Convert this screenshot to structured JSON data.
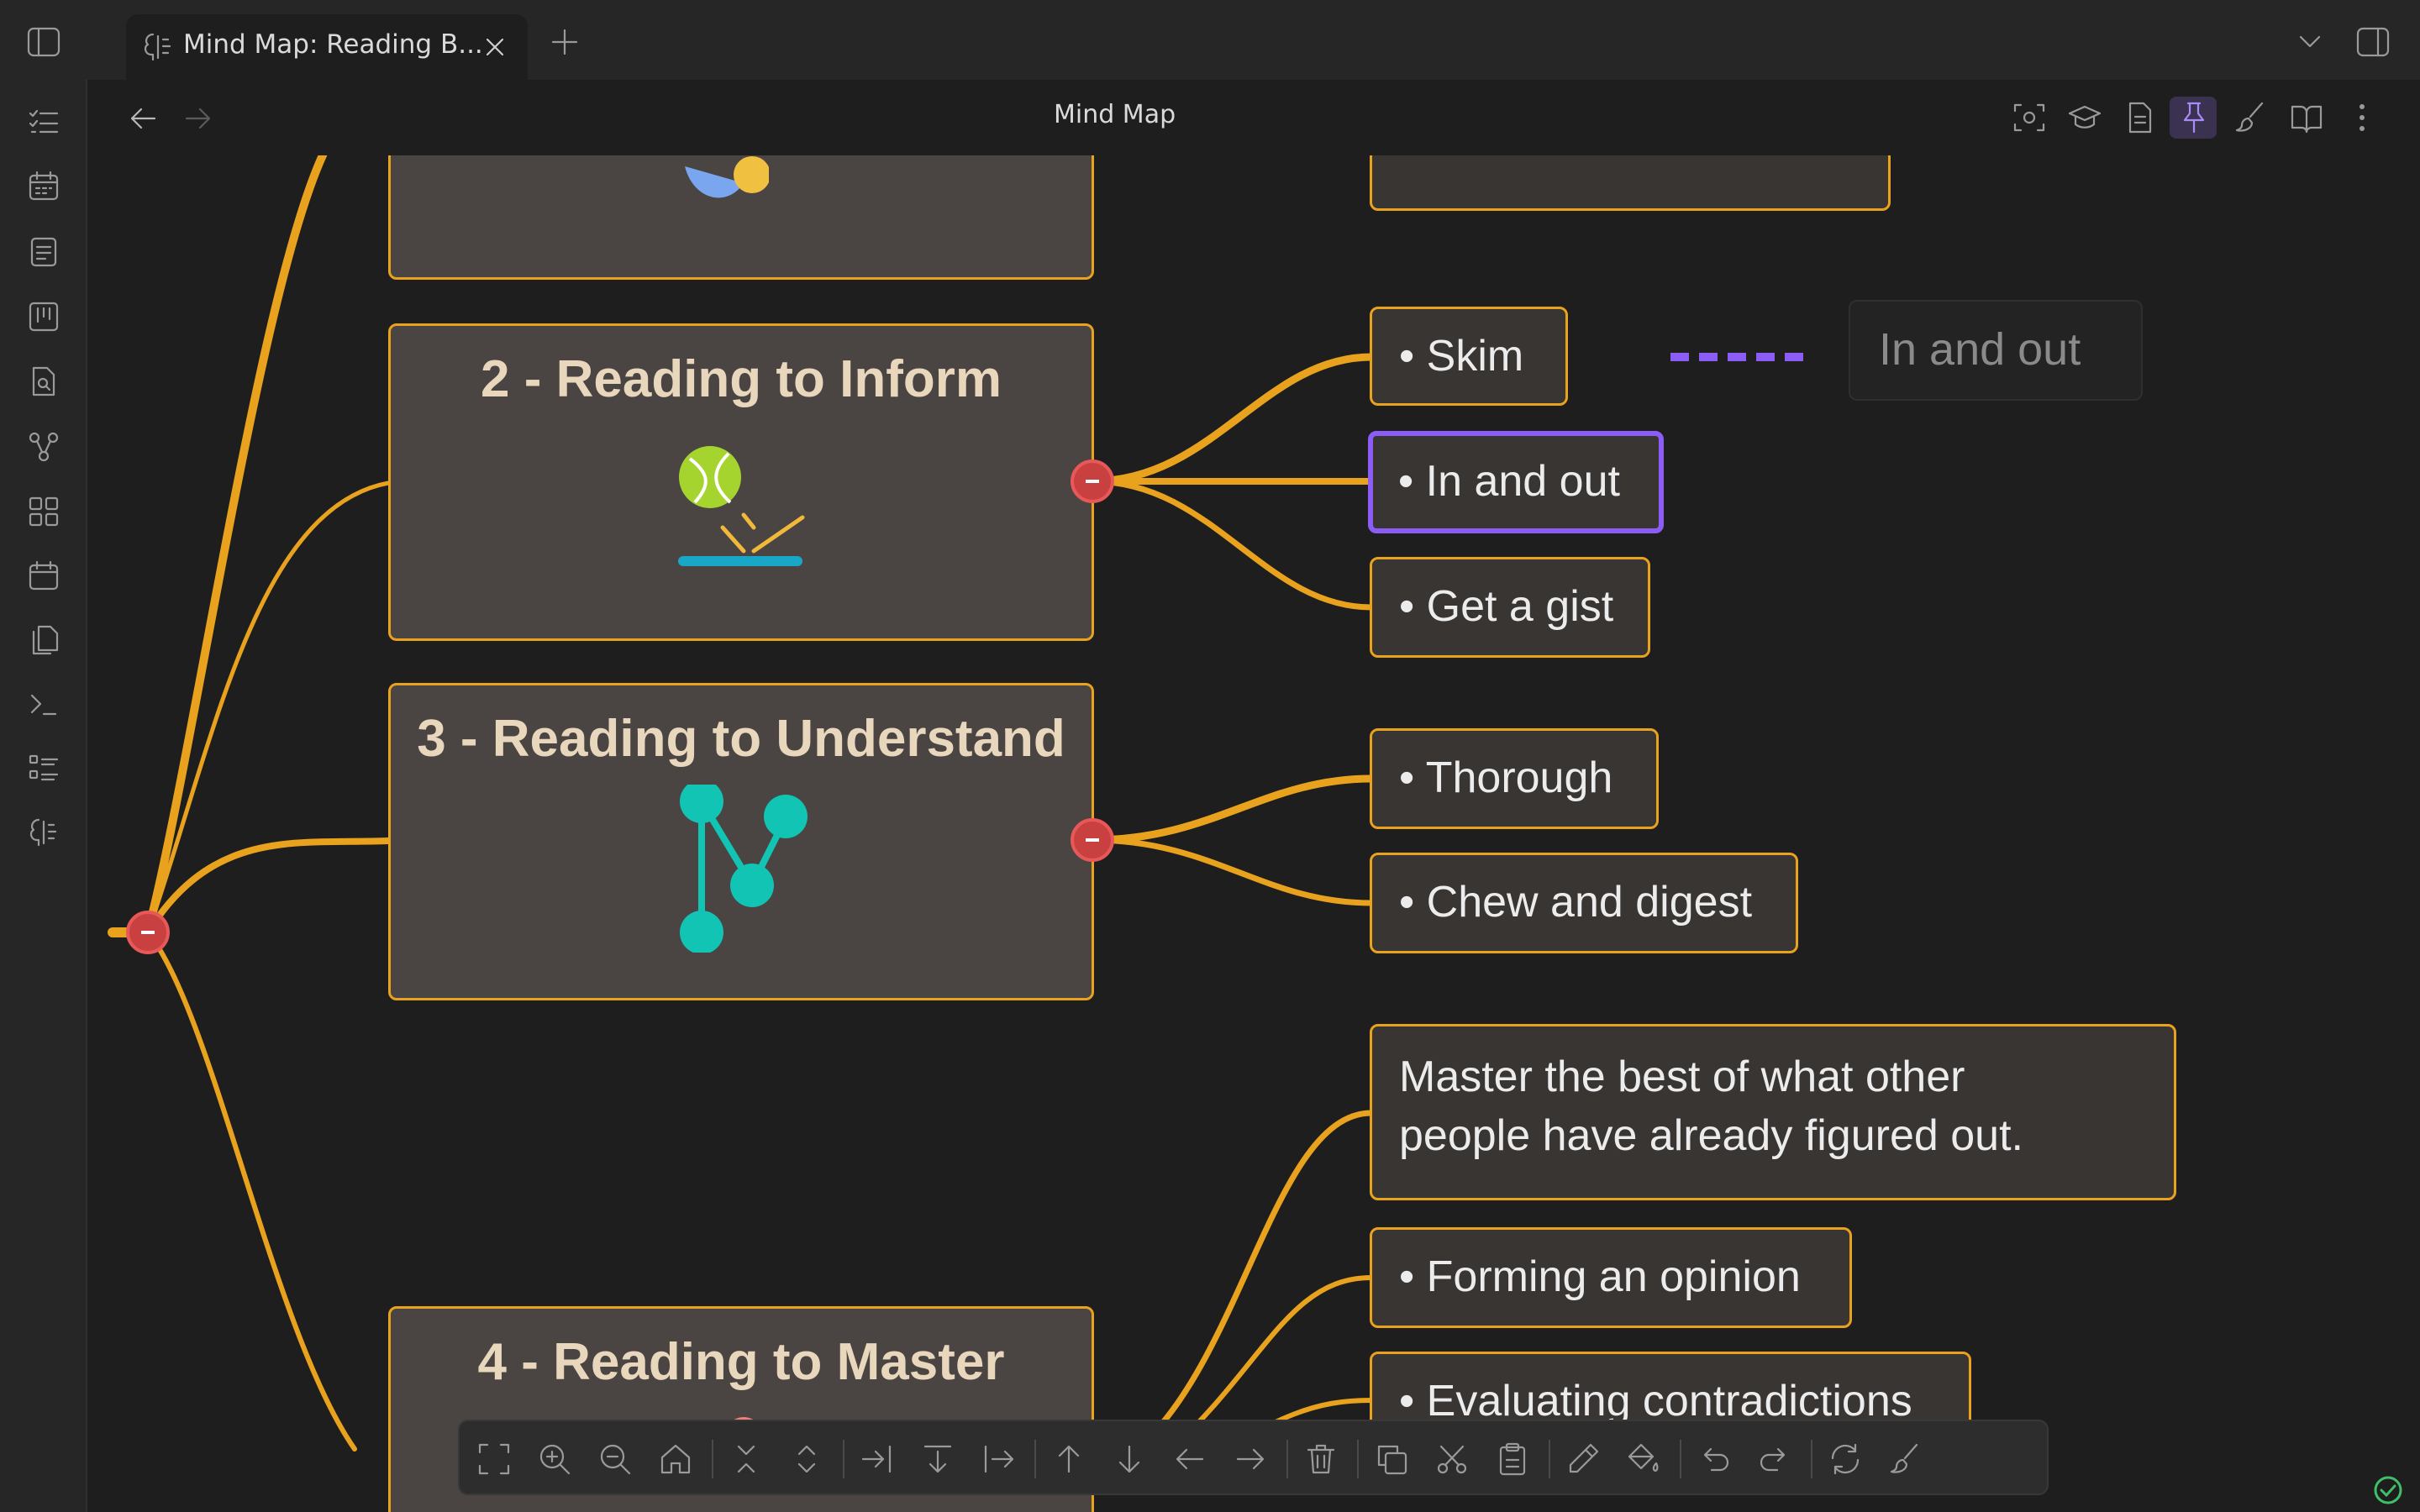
{
  "tab": {
    "title": "Mind Map: Reading B..."
  },
  "header": {
    "title": "Mind Map"
  },
  "nodes": {
    "inform_title": "2 - Reading to Inform",
    "understand_title": "3 - Reading to Understand",
    "master_title": "4 - Reading to Master",
    "skim": "• Skim",
    "in_and_out": "• In and out",
    "gist": "• Get a gist",
    "thorough": "• Thorough",
    "chew": "• Chew and digest",
    "master_line1": "Master the best of what other",
    "master_line2": "people have already figured out.",
    "opinion": "• Forming an opinion",
    "contradictions": "• Evaluating contradictions",
    "ghost": "In and out"
  },
  "colors": {
    "branch": "#e8a21e",
    "selection": "#8b5cf6",
    "collapse": "#c94040",
    "node_bg": "#383533",
    "root_node_bg": "#4a4542"
  }
}
